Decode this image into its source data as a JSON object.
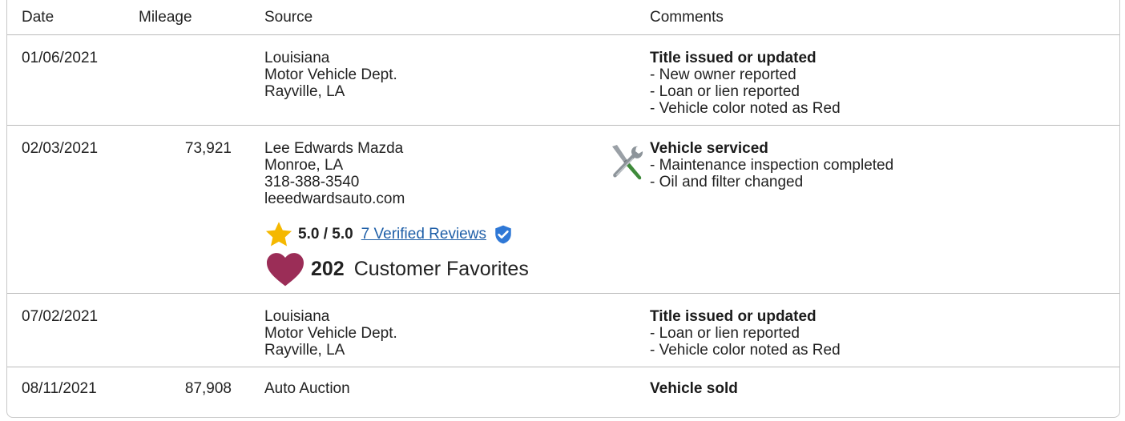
{
  "columns": {
    "date": "Date",
    "mileage": "Mileage",
    "source": "Source",
    "comments": "Comments"
  },
  "rows": [
    {
      "date": "01/06/2021",
      "mileage": "",
      "source": [
        "Louisiana",
        "Motor Vehicle Dept.",
        "Rayville, LA"
      ],
      "comment_title": "Title issued or updated",
      "comment_items": [
        "- New owner reported",
        "- Loan or lien reported",
        "- Vehicle color noted as Red"
      ]
    },
    {
      "date": "02/03/2021",
      "mileage": "73,921",
      "source": [
        "Lee Edwards Mazda",
        "Monroe, LA",
        "318-388-3540",
        "leeedwardsauto.com"
      ],
      "rating": {
        "score": "5.0 / 5.0",
        "reviews_link": "7 Verified Reviews"
      },
      "favorites": {
        "count": "202",
        "label": "Customer Favorites"
      },
      "comment_icon": "service-tools-icon",
      "comment_title": "Vehicle serviced",
      "comment_items": [
        "- Maintenance inspection completed",
        "- Oil and filter changed"
      ]
    },
    {
      "date": "07/02/2021",
      "mileage": "",
      "source": [
        "Louisiana",
        "Motor Vehicle Dept.",
        "Rayville, LA"
      ],
      "comment_title": "Title issued or updated",
      "comment_items": [
        "- Loan or lien reported",
        "- Vehicle color noted as Red"
      ]
    },
    {
      "date": "08/11/2021",
      "mileage": "87,908",
      "source": [
        "Auto Auction"
      ],
      "comment_title": "Vehicle sold",
      "comment_items": []
    }
  ],
  "colors": {
    "link": "#1f5fa8",
    "star": "#f5b800",
    "heart": "#9b2d57",
    "verified": "#2f78d6"
  }
}
